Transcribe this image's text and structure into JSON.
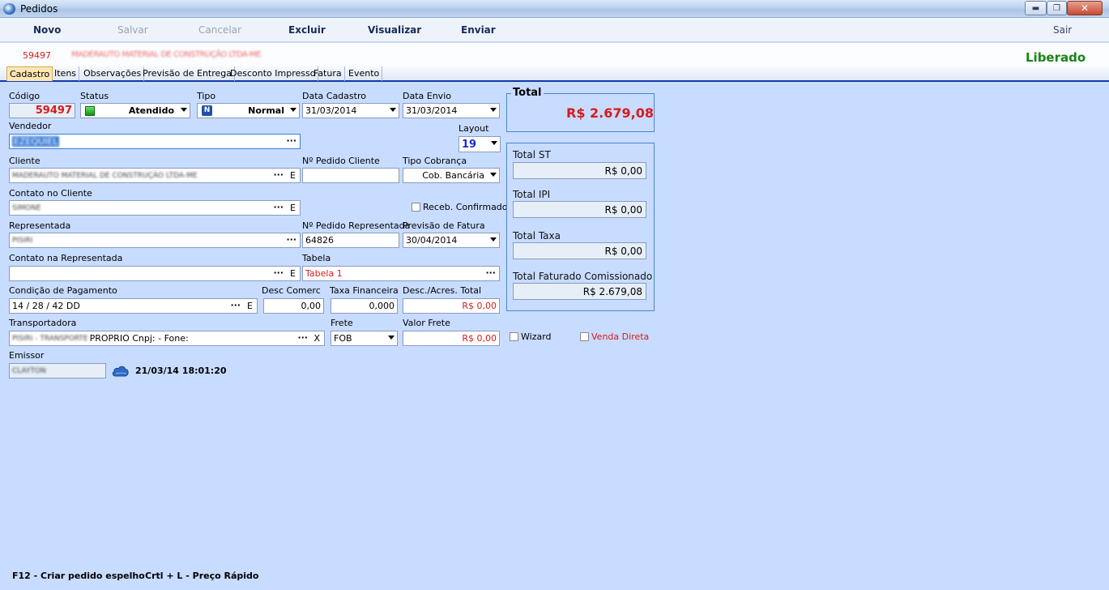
{
  "window": {
    "title": "Pedidos",
    "min_glyph": "▬",
    "max_glyph": "❐",
    "close_glyph": "✕"
  },
  "toolbar": {
    "novo": "Novo",
    "salvar": "Salvar",
    "cancelar": "Cancelar",
    "excluir": "Excluir",
    "visualizar": "Visualizar",
    "enviar": "Enviar",
    "sair": "Sair"
  },
  "header": {
    "order_code": "59497",
    "client_name": "MADERAUTO MATERIAL DE CONSTRUÇÃO LTDA-ME",
    "status": "Liberado"
  },
  "tabs": [
    "Cadastro",
    "Itens",
    "Observações",
    "Previsão de Entrega",
    "Desconto Impresso",
    "Fatura",
    "Evento"
  ],
  "form": {
    "codigo": {
      "label": "Código",
      "value": "59497"
    },
    "status": {
      "label": "Status",
      "value": "Atendido"
    },
    "tipo": {
      "label": "Tipo",
      "value": "Normal",
      "badge": "N"
    },
    "data_cadastro": {
      "label": "Data Cadastro",
      "value": "31/03/2014"
    },
    "data_envio": {
      "label": "Data Envio",
      "value": "31/03/2014"
    },
    "vendedor": {
      "label": "Vendedor",
      "value": "EZEQUIEL"
    },
    "layout": {
      "label": "Layout",
      "value": "19"
    },
    "cliente": {
      "label": "Cliente",
      "value": "MADERAUTO MATERIAL DE CONSTRUÇÃO LTDA-ME"
    },
    "pedido_cliente": {
      "label": "Nº Pedido Cliente",
      "value": ""
    },
    "tipo_cobranca": {
      "label": "Tipo Cobrança",
      "value": "Cob. Bancária"
    },
    "contato_cliente": {
      "label": "Contato no Cliente",
      "value": "SIMONE"
    },
    "receb_confirmado": {
      "label": "Receb. Confirmado",
      "checked": false
    },
    "representada": {
      "label": "Representada",
      "value": "PISIRI"
    },
    "pedido_representada": {
      "label": "Nº Pedido Representada",
      "value": "64826"
    },
    "previsao_fatura": {
      "label": "Previsão de Fatura",
      "value": "30/04/2014"
    },
    "contato_representada": {
      "label": "Contato na Representada",
      "value": ""
    },
    "tabela": {
      "label": "Tabela",
      "value": "Tabela 1"
    },
    "condicao_pagamento": {
      "label": "Condição de Pagamento",
      "value": "14 / 28 / 42 DD"
    },
    "desc_comerc": {
      "label": "Desc Comerc",
      "value": "0,00"
    },
    "taxa_financeira": {
      "label": "Taxa Financeira",
      "value": "0,000"
    },
    "desc_acres_total": {
      "label": "Desc./Acres. Total",
      "value": "R$ 0,00"
    },
    "transportadora": {
      "label": "Transportadora",
      "value_hidden": "PISIRI - TRANSPORTE",
      "value": "PROPRIO Cnpj: - Fone:"
    },
    "frete": {
      "label": "Frete",
      "value": "FOB"
    },
    "valor_frete": {
      "label": "Valor Frete",
      "value": "R$ 0,00"
    },
    "emissor": {
      "label": "Emissor",
      "value": "CLAYTON",
      "timestamp": "21/03/14 18:01:20"
    },
    "ellipsis": "···",
    "edit_letter": "E",
    "clear_letter": "X"
  },
  "totals": {
    "total": {
      "label": "Total",
      "value": "R$ 2.679,08"
    },
    "total_st": {
      "label": "Total ST",
      "value": "R$ 0,00"
    },
    "total_ipi": {
      "label": "Total IPI",
      "value": "R$ 0,00"
    },
    "total_taxa": {
      "label": "Total Taxa",
      "value": "R$ 0,00"
    },
    "total_faturado": {
      "label": "Total Faturado Comissionado",
      "value": "R$ 2.679,08"
    }
  },
  "options": {
    "wizard": {
      "label": "Wizard",
      "checked": false
    },
    "venda_direta": {
      "label": "Venda Direta",
      "checked": false
    }
  },
  "footer": {
    "f12": "F12 - Criar pedido espelho",
    "ctrl_l": "Crtl + L - Preço Rápido"
  },
  "colors": {
    "background": "#c8dcff",
    "accent_red": "#d81b1b",
    "status_green": "#178417",
    "tab_active": "#ffe7b3"
  }
}
